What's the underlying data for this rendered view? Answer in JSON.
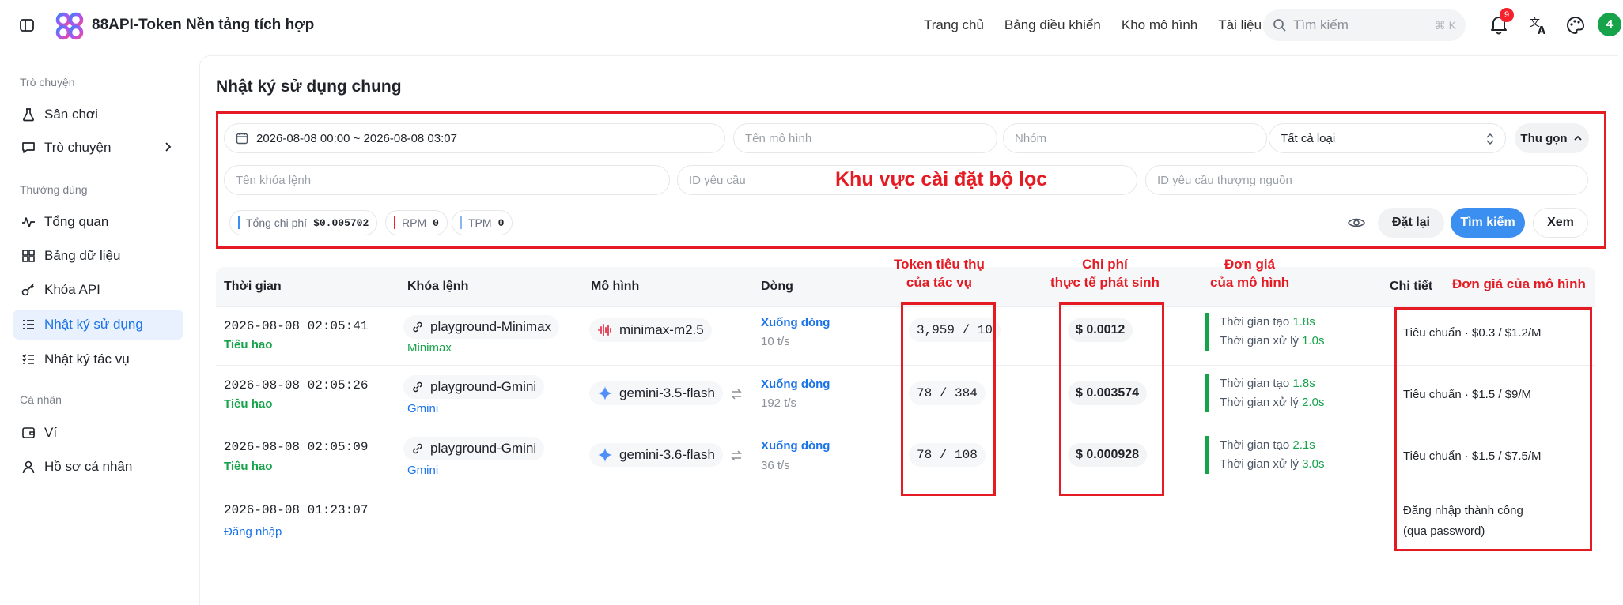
{
  "header": {
    "app_title": "88API-Token Nền tảng tích hợp",
    "nav": [
      "Trang chủ",
      "Bảng điều khiển",
      "Kho mô hình",
      "Tài liệu"
    ],
    "search_placeholder": "Tìm kiếm",
    "search_shortcut": "⌘ K",
    "notification_count": "9",
    "avatar_letter": "4",
    "accent_color": "#3b8ff0"
  },
  "sidebar": {
    "sections": [
      {
        "title": "Trò chuyện",
        "items": [
          {
            "label": "Sân chơi",
            "icon": "flask-icon"
          },
          {
            "label": "Trò chuyện",
            "icon": "chat-icon"
          }
        ]
      },
      {
        "title": "Thường dùng",
        "items": [
          {
            "label": "Tổng quan",
            "icon": "activity-icon"
          },
          {
            "label": "Bảng dữ liệu",
            "icon": "grid-icon"
          },
          {
            "label": "Khóa API",
            "icon": "key-icon"
          },
          {
            "label": "Nhật ký sử dụng",
            "icon": "log-icon",
            "active": true
          },
          {
            "label": "Nhật ký tác vụ",
            "icon": "tasks-icon"
          }
        ]
      },
      {
        "title": "Cá nhân",
        "items": [
          {
            "label": "Ví",
            "icon": "wallet-icon"
          },
          {
            "label": "Hồ sơ cá nhân",
            "icon": "user-icon"
          }
        ]
      }
    ]
  },
  "page": {
    "title": "Nhật ký sử dụng chung"
  },
  "filters": {
    "date_range": "2026-08-08 00:00 ~ 2026-08-08 03:07",
    "model_placeholder": "Tên mô hình",
    "group_placeholder": "Nhóm",
    "type_value": "Tất cả loại",
    "collapse_label": "Thu gọn",
    "key_placeholder": "Tên khóa lệnh",
    "request_id_placeholder": "ID yêu cầu",
    "upstream_id_placeholder": "ID yêu cầu thượng nguồn",
    "area_note": "Khu vực cài đặt bộ lọc",
    "stats": [
      {
        "label": "Tổng chi phí",
        "value": "$0.005702",
        "color": "#3b8ff0"
      },
      {
        "label": "RPM",
        "value": "0",
        "color": "#f5222d"
      },
      {
        "label": "TPM",
        "value": "0",
        "color": "#8bb4f0"
      }
    ],
    "reset_label": "Đặt lại",
    "search_label": "Tìm kiếm",
    "view_label": "Xem"
  },
  "table": {
    "columns": [
      "Thời gian",
      "Khóa lệnh",
      "Mô hình",
      "Dòng",
      "Chi tiết"
    ],
    "rows": [
      {
        "time": "2026-08-08 02:05:41",
        "type": "Tiêu hao",
        "key": "playground-Minimax",
        "group": "Minimax",
        "model": "minimax-m2.5",
        "stream": "Xuống dòng",
        "tps": "10 t/s",
        "tokens": "3,959 / 10",
        "cost": "$ 0.0012",
        "create_label": "Thời gian tạo",
        "create_time": "1.8s",
        "process_label": "Thời gian xử lý",
        "process_time": "1.0s",
        "detail": "Tiêu chuẩn  ·  $0.3 / $1.2/M"
      },
      {
        "time": "2026-08-08 02:05:26",
        "type": "Tiêu hao",
        "key": "playground-Gmini",
        "group": "Gmini",
        "model": "gemini-3.5-flash",
        "stream": "Xuống dòng",
        "tps": "192 t/s",
        "tokens": "78  /  384",
        "cost": "$ 0.003574",
        "create_label": "Thời gian tạo",
        "create_time": "1.8s",
        "process_label": "Thời gian xử lý",
        "process_time": "2.0s",
        "detail": "Tiêu chuẩn  ·  $1.5 / $9/M"
      },
      {
        "time": "2026-08-08 02:05:09",
        "type": "Tiêu hao",
        "key": "playground-Gmini",
        "group": "Gmini",
        "model": "gemini-3.6-flash",
        "stream": "Xuống dòng",
        "tps": "36 t/s",
        "tokens": "78  /  108",
        "cost": "$ 0.000928",
        "create_label": "Thời gian tạo",
        "create_time": "2.1s",
        "process_label": "Thời gian xử lý",
        "process_time": "3.0s",
        "detail": "Tiêu chuẩn  ·  $1.5 / $7.5/M"
      },
      {
        "time": "2026-08-08 01:23:07",
        "type": "Đăng nhập",
        "detail_line1": "Đăng nhập thành công",
        "detail_line2": "(qua password)"
      }
    ]
  },
  "annotations": {
    "token_line1": "Token tiêu thụ",
    "token_line2": "của tác vụ",
    "cost_line1": "Chi phí",
    "cost_line2": "thực tế phát sinh",
    "price_line1": "Đơn giá",
    "price_line2": "của mô hình",
    "detail_note": "Đơn giá của mô hình"
  }
}
